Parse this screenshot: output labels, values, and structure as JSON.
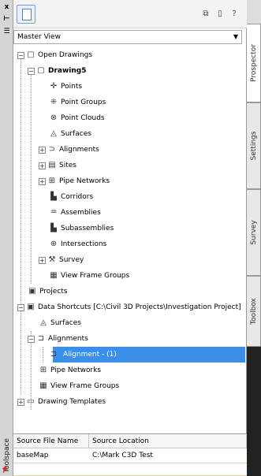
{
  "leftbar": {
    "close": "x",
    "pin": "⊢",
    "menu": "☰",
    "title": "Toolspace"
  },
  "toolbar": {
    "btn_a": "⧉",
    "btn_b": "▯",
    "btn_c": "?"
  },
  "view_selector": {
    "value": "Master View"
  },
  "tree": {
    "open_drawings": "Open Drawings",
    "drawing": "Drawing5",
    "points": "Points",
    "point_groups": "Point Groups",
    "point_clouds": "Point Clouds",
    "surfaces": "Surfaces",
    "alignments": "Alignments",
    "sites": "Sites",
    "pipe_networks": "Pipe Networks",
    "corridors": "Corridors",
    "assemblies": "Assemblies",
    "subassemblies": "Subassemblies",
    "intersections": "Intersections",
    "survey": "Survey",
    "view_frame_groups": "View Frame Groups",
    "projects": "Projects",
    "data_shortcuts": "Data Shortcuts [C:\\Civil 3D Projects\\Investigation Project]",
    "ds_surfaces": "Surfaces",
    "ds_alignments": "Alignments",
    "ds_alignment_item": "Alignment - (1)",
    "ds_pipe_networks": "Pipe Networks",
    "ds_view_frame_groups": "View Frame Groups",
    "drawing_templates": "Drawing Templates"
  },
  "table": {
    "headers": [
      "Source File Name",
      "Source Location"
    ],
    "rows": [
      [
        "baseMap",
        "C:\\Mark C3D Test"
      ]
    ]
  },
  "tabs": [
    "Prospector",
    "Settings",
    "Survey",
    "Toolbox"
  ],
  "colors": {
    "selection": "#3b8fe8"
  }
}
